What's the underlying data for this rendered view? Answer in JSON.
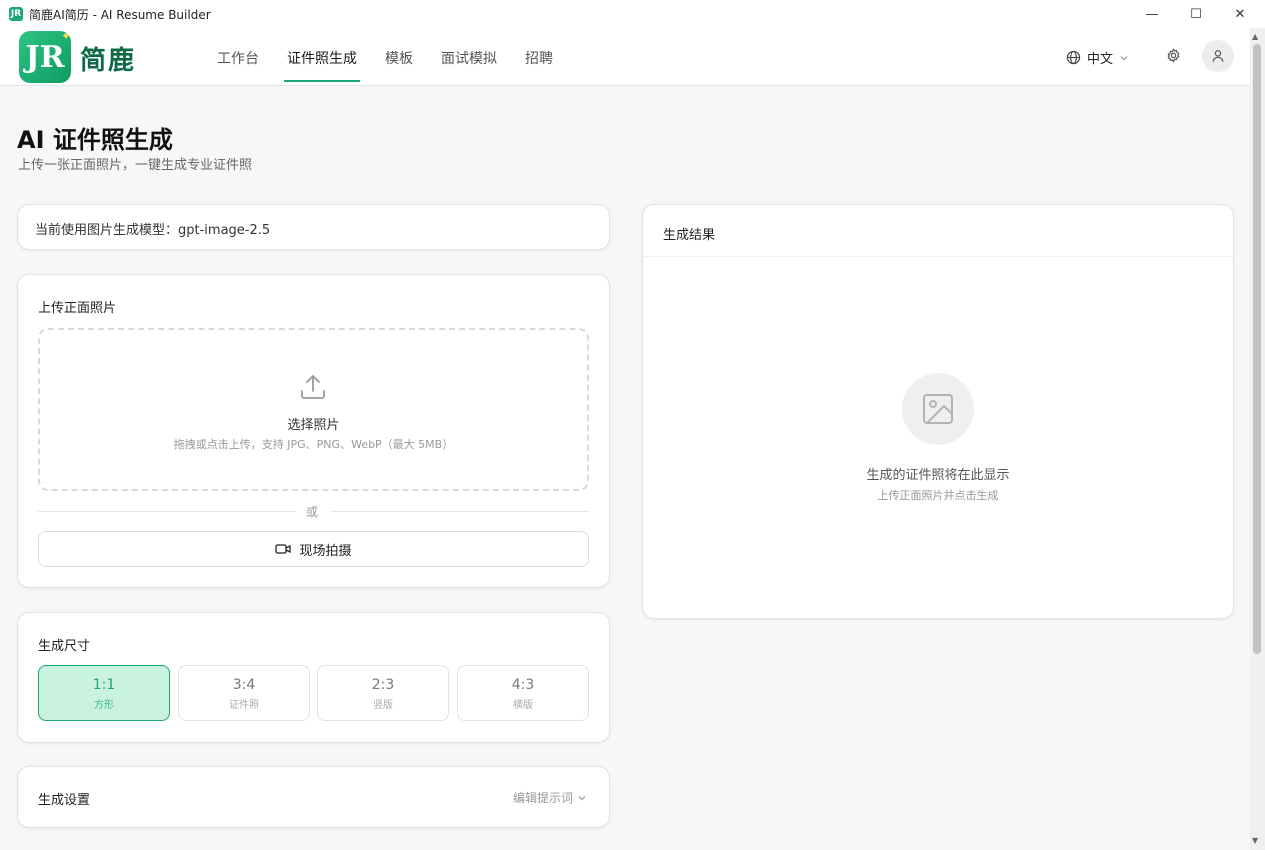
{
  "window": {
    "title": "简鹿AI简历 - AI Resume Builder",
    "icon_text": "JR",
    "controls": [
      "minimize-icon",
      "maximize-icon",
      "close-icon"
    ]
  },
  "nav": {
    "logo_mark": "JR",
    "logo_text": "简鹿",
    "items": [
      "工作台",
      "证件照生成",
      "模板",
      "面试模拟",
      "招聘"
    ],
    "active_index": 1,
    "language": "中文"
  },
  "page": {
    "title": "AI 证件照生成",
    "subtitle": "上传一张正面照片，一键生成专业证件照"
  },
  "model_card": {
    "text": "当前使用图片生成模型：gpt-image-2.5"
  },
  "upload": {
    "label": "上传正面照片",
    "dropzone_title": "选择照片",
    "dropzone_hint": "拖拽或点击上传，支持 JPG、PNG、WebP（最大 5MB）",
    "or": "或",
    "shoot_label": "现场拍摄"
  },
  "size": {
    "label": "生成尺寸",
    "options": [
      {
        "ratio": "1:1",
        "desc": "方形"
      },
      {
        "ratio": "3:4",
        "desc": "证件照"
      },
      {
        "ratio": "2:3",
        "desc": "竖版"
      },
      {
        "ratio": "4:3",
        "desc": "横版"
      }
    ],
    "selected_index": 0
  },
  "settings": {
    "label": "生成设置",
    "edit_prompt": "编辑提示词"
  },
  "result": {
    "label": "生成结果",
    "placeholder_title": "生成的证件照将在此显示",
    "placeholder_sub": "上传正面照片并点击生成"
  },
  "colors": {
    "accent": "#1aa874",
    "accent_light": "#c9f2df",
    "logo_text": "#0e6a46"
  }
}
